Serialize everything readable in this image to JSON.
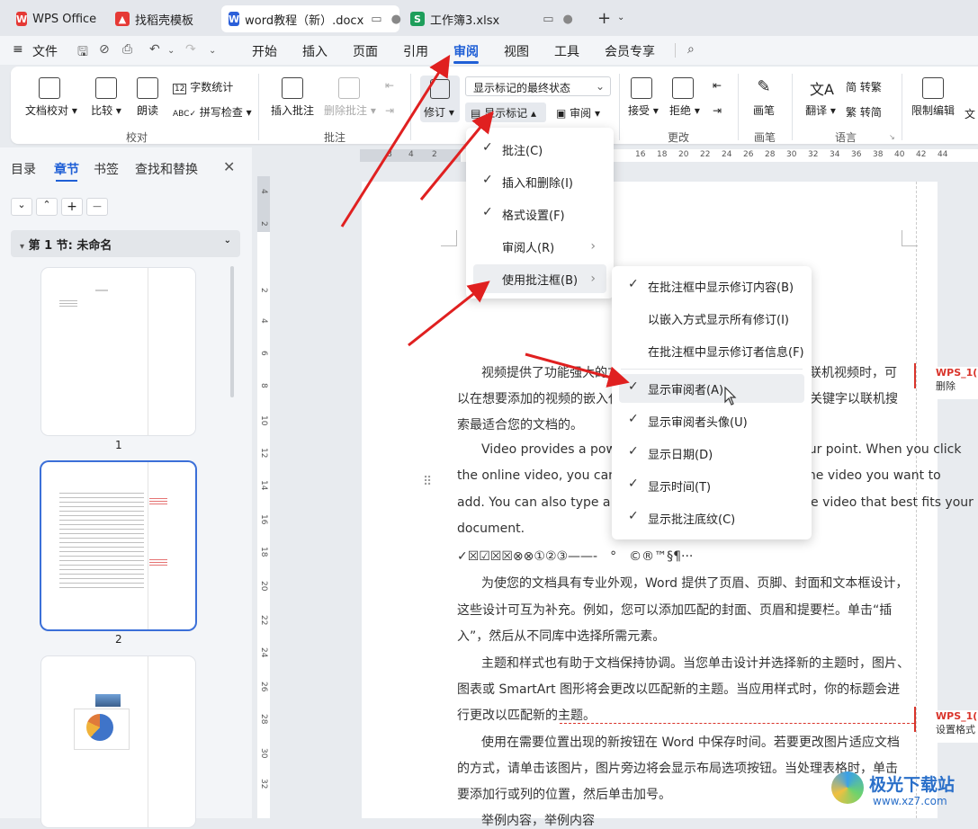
{
  "tabs": [
    {
      "label": "WPS Office",
      "icon": "wps-logo-icon",
      "color": "#e53935"
    },
    {
      "label": "找稻壳模板",
      "icon": "docer-icon",
      "color": "#e53935"
    },
    {
      "label": "word教程（新）.docx",
      "icon": "W",
      "color": "#2b5fd9"
    },
    {
      "label": "工作簿3.xlsx",
      "icon": "S",
      "color": "#1e9e5b"
    }
  ],
  "menubar": {
    "file": "文件",
    "items": [
      "开始",
      "插入",
      "页面",
      "引用",
      "审阅",
      "视图",
      "工具",
      "会员专享"
    ],
    "active": "审阅"
  },
  "ribbon": {
    "doc_check": "文档校对",
    "compare": "比较",
    "read_aloud": "朗读",
    "word_count": "字数统计",
    "spell_check": "拼写检查",
    "group_proof": "校对",
    "insert_comment": "插入批注",
    "delete_comment": "删除批注",
    "group_comment": "批注",
    "track": "修订",
    "markup_state": "显示标记的最终状态",
    "show_markup": "显示标记",
    "reviewing_pane": "审阅",
    "accept": "接受",
    "reject": "拒绝",
    "group_change": "更改",
    "pen": "画笔",
    "group_pen": "画笔",
    "translate": "翻译",
    "trad": "简 转繁",
    "simp": "繁 转简",
    "group_lang": "语言",
    "restrict": "限制编辑",
    "more": "文"
  },
  "leftpanel": {
    "tabs": [
      "目录",
      "章节",
      "书签",
      "查找和替换"
    ],
    "active": "章节",
    "section": "第 1 节: 未命名",
    "pages": [
      "1",
      "2"
    ]
  },
  "ruler": {
    "h": [
      "8",
      "4",
      "2",
      "16",
      "18",
      "20",
      "22",
      "24",
      "26",
      "28",
      "30",
      "32",
      "34",
      "36",
      "38",
      "40",
      "42",
      "44"
    ],
    "v": [
      "4",
      "2",
      "2",
      "4",
      "6",
      "8",
      "10",
      "12",
      "14",
      "16",
      "18",
      "20",
      "22",
      "24",
      "26",
      "28",
      "30",
      "32"
    ]
  },
  "doc": {
    "lines": [
      "视频提供了功能强大的方法帮助您证明您的观点。当您单击联机视频时，可",
      "以在想要添加的视频的嵌入代码中进行粘贴。您也可以键入一个关键字以联机搜",
      "索最适合您的文档的。",
      "Video provides a powerful way to help you prove your point. When you click",
      "the online video, you can paste in the embed code for the video you want to",
      "add. You can also type a keyword to search online for the video that best fits your",
      "document.",
      "✓☒☑☒☒⊗⊗①②③——-　°　©®™§¶···",
      "为使您的文档具有专业外观，Word 提供了页眉、页脚、封面和文本框设计，",
      "这些设计可互为补充。例如，您可以添加匹配的封面、页眉和提要栏。单击“插",
      "入”，然后从不同库中选择所需元素。",
      "主题和样式也有助于文档保持协调。当您单击设计并选择新的主题时，图片、",
      "图表或 SmartArt 图形将会更改以匹配新的主题。当应用样式时，你的标题会进",
      "行更改以匹配新的主题。",
      "使用在需要位置出现的新按钮在 Word 中保存时间。若要更改图片适应文档",
      "的方式，请单击该图片，图片旁边将会显示布局选项按钮。当处理表格时，单击",
      "要添加行或列的位置，然后单击加号。",
      "举例内容，举例内容"
    ],
    "comment1": {
      "author": "WPS_1(",
      "action": "删除"
    },
    "comment2": {
      "author": "WPS_1(",
      "action": "设置格式"
    }
  },
  "menu_markup": {
    "items": [
      {
        "label": "批注(C)",
        "checked": true
      },
      {
        "label": "插入和删除(I)",
        "checked": true
      },
      {
        "label": "格式设置(F)",
        "checked": true
      },
      {
        "label": "审阅人(R)",
        "checked": false,
        "sub": true
      },
      {
        "label": "使用批注框(B)",
        "checked": false,
        "sub": true
      }
    ]
  },
  "menu_balloon": {
    "items": [
      {
        "label": "在批注框中显示修订内容(B)",
        "checked": true
      },
      {
        "label": "以嵌入方式显示所有修订(I)",
        "checked": false
      },
      {
        "label": "在批注框中显示修订者信息(F)",
        "checked": false
      },
      {
        "label": "显示审阅者(A)",
        "checked": true
      },
      {
        "label": "显示审阅者头像(U)",
        "checked": true
      },
      {
        "label": "显示日期(D)",
        "checked": true
      },
      {
        "label": "显示时间(T)",
        "checked": true
      },
      {
        "label": "显示批注底纹(C)",
        "checked": true
      }
    ]
  },
  "watermark": {
    "title": "极光下载站",
    "url": "www.xz7.com"
  },
  "colors": {
    "accent": "#1f5fd6",
    "arrow": "#e02020",
    "comment": "#d9342b"
  }
}
